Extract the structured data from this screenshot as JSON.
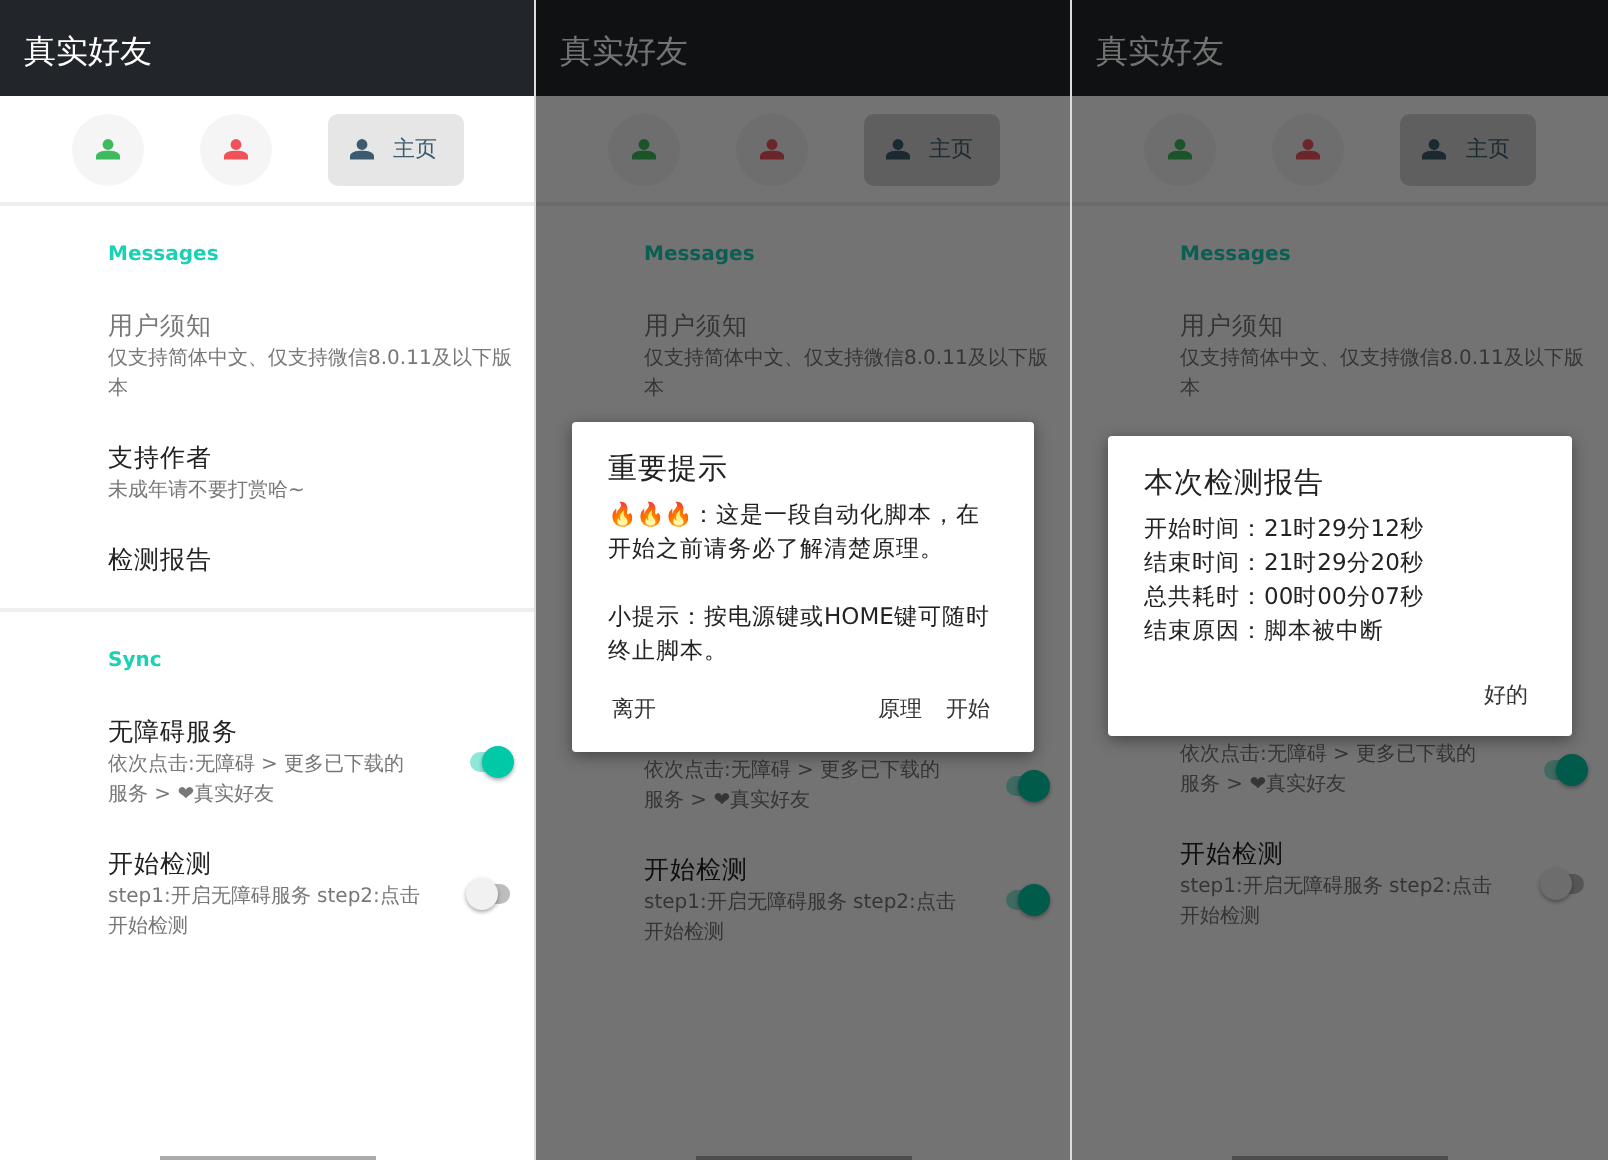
{
  "screens": [
    {
      "app_bar": {
        "title": "真实好友"
      },
      "tabs": [
        {
          "color": "#3dbb5c",
          "selected": false
        },
        {
          "color": "#f0525a",
          "selected": false
        },
        {
          "color": "#3d5b6e",
          "label": "主页",
          "selected": true
        }
      ],
      "rows": [
        {
          "kind": "section",
          "title": "Messages"
        },
        {
          "kind": "item",
          "title": "用户须知",
          "subtitle": "仅支持简体中文、仅支持微信8.0.11及以下版本",
          "disabled": true
        },
        {
          "kind": "item",
          "title": "支持作者",
          "subtitle": "未成年请不要打赏哈~",
          "disabled": false
        },
        {
          "kind": "item",
          "title": "检测报告",
          "disabled": false
        },
        {
          "kind": "divider"
        },
        {
          "kind": "section",
          "title": "Sync"
        },
        {
          "kind": "switch",
          "title": "无障碍服务",
          "subtitle": "依次点击:无障碍 > 更多已下载的服务 > ❤真实好友",
          "on": true
        },
        {
          "kind": "switch",
          "title": "开始检测",
          "subtitle": "step1:开启无障碍服务 step2:点击开始检测",
          "on": false
        }
      ]
    },
    {
      "app_bar": {
        "title": "真实好友"
      },
      "tabs": [
        {
          "color": "#1b5429",
          "selected": false
        },
        {
          "color": "#6c2528",
          "selected": false
        },
        {
          "color": "#1b2931",
          "label": "主页",
          "selected": true
        }
      ],
      "rows": [
        {
          "kind": "section",
          "title": "Messages"
        },
        {
          "kind": "item",
          "title": "用户须知",
          "subtitle": "仅支持简体中文、仅支持微信8.0.11及以下版本",
          "disabled": true
        },
        {
          "kind": "dialog",
          "title": "重要提示",
          "paragraphs": [
            "🔥🔥🔥：这是一段自动化脚本，在开始之前请务必了解清楚原理。",
            "小提示：按电源键或HOME键可随时终止脚本。"
          ],
          "buttons": [
            {
              "label": "离开",
              "kind": "neutral"
            },
            {
              "label": "原理",
              "kind": "action"
            },
            {
              "label": "开始",
              "kind": "action"
            }
          ]
        },
        {
          "kind": "switch",
          "subtitle": "依次点击:无障碍 > 更多已下载的服务 > ❤真实好友",
          "on": true
        },
        {
          "kind": "switch",
          "title": "开始检测",
          "subtitle": "step1:开启无障碍服务 step2:点击开始检测",
          "on": true
        }
      ]
    },
    {
      "app_bar": {
        "title": "真实好友"
      },
      "tabs": [
        {
          "color": "#1b5429",
          "selected": false
        },
        {
          "color": "#6c2528",
          "selected": false
        },
        {
          "color": "#1b2931",
          "label": "主页",
          "selected": true
        }
      ],
      "rows": [
        {
          "kind": "section",
          "title": "Messages"
        },
        {
          "kind": "item",
          "title": "用户须知",
          "subtitle": "仅支持简体中文、仅支持微信8.0.11及以下版本",
          "disabled": true
        },
        {
          "kind": "dialog",
          "title": "本次检测报告",
          "paragraphs": [
            "开始时间：21时29分12秒",
            "结束时间：21时29分20秒",
            "总共耗时：00时00分07秒",
            "结束原因：脚本被中断"
          ],
          "buttons": [
            {
              "label": "好的",
              "kind": "action"
            }
          ]
        },
        {
          "kind": "switch",
          "subtitle": "依次点击:无障碍 > 更多已下载的服务 > ❤真实好友",
          "on": true
        },
        {
          "kind": "switch",
          "title": "开始检测",
          "subtitle": "step1:开启无障碍服务 step2:点击开始检测",
          "on": false
        }
      ]
    }
  ]
}
